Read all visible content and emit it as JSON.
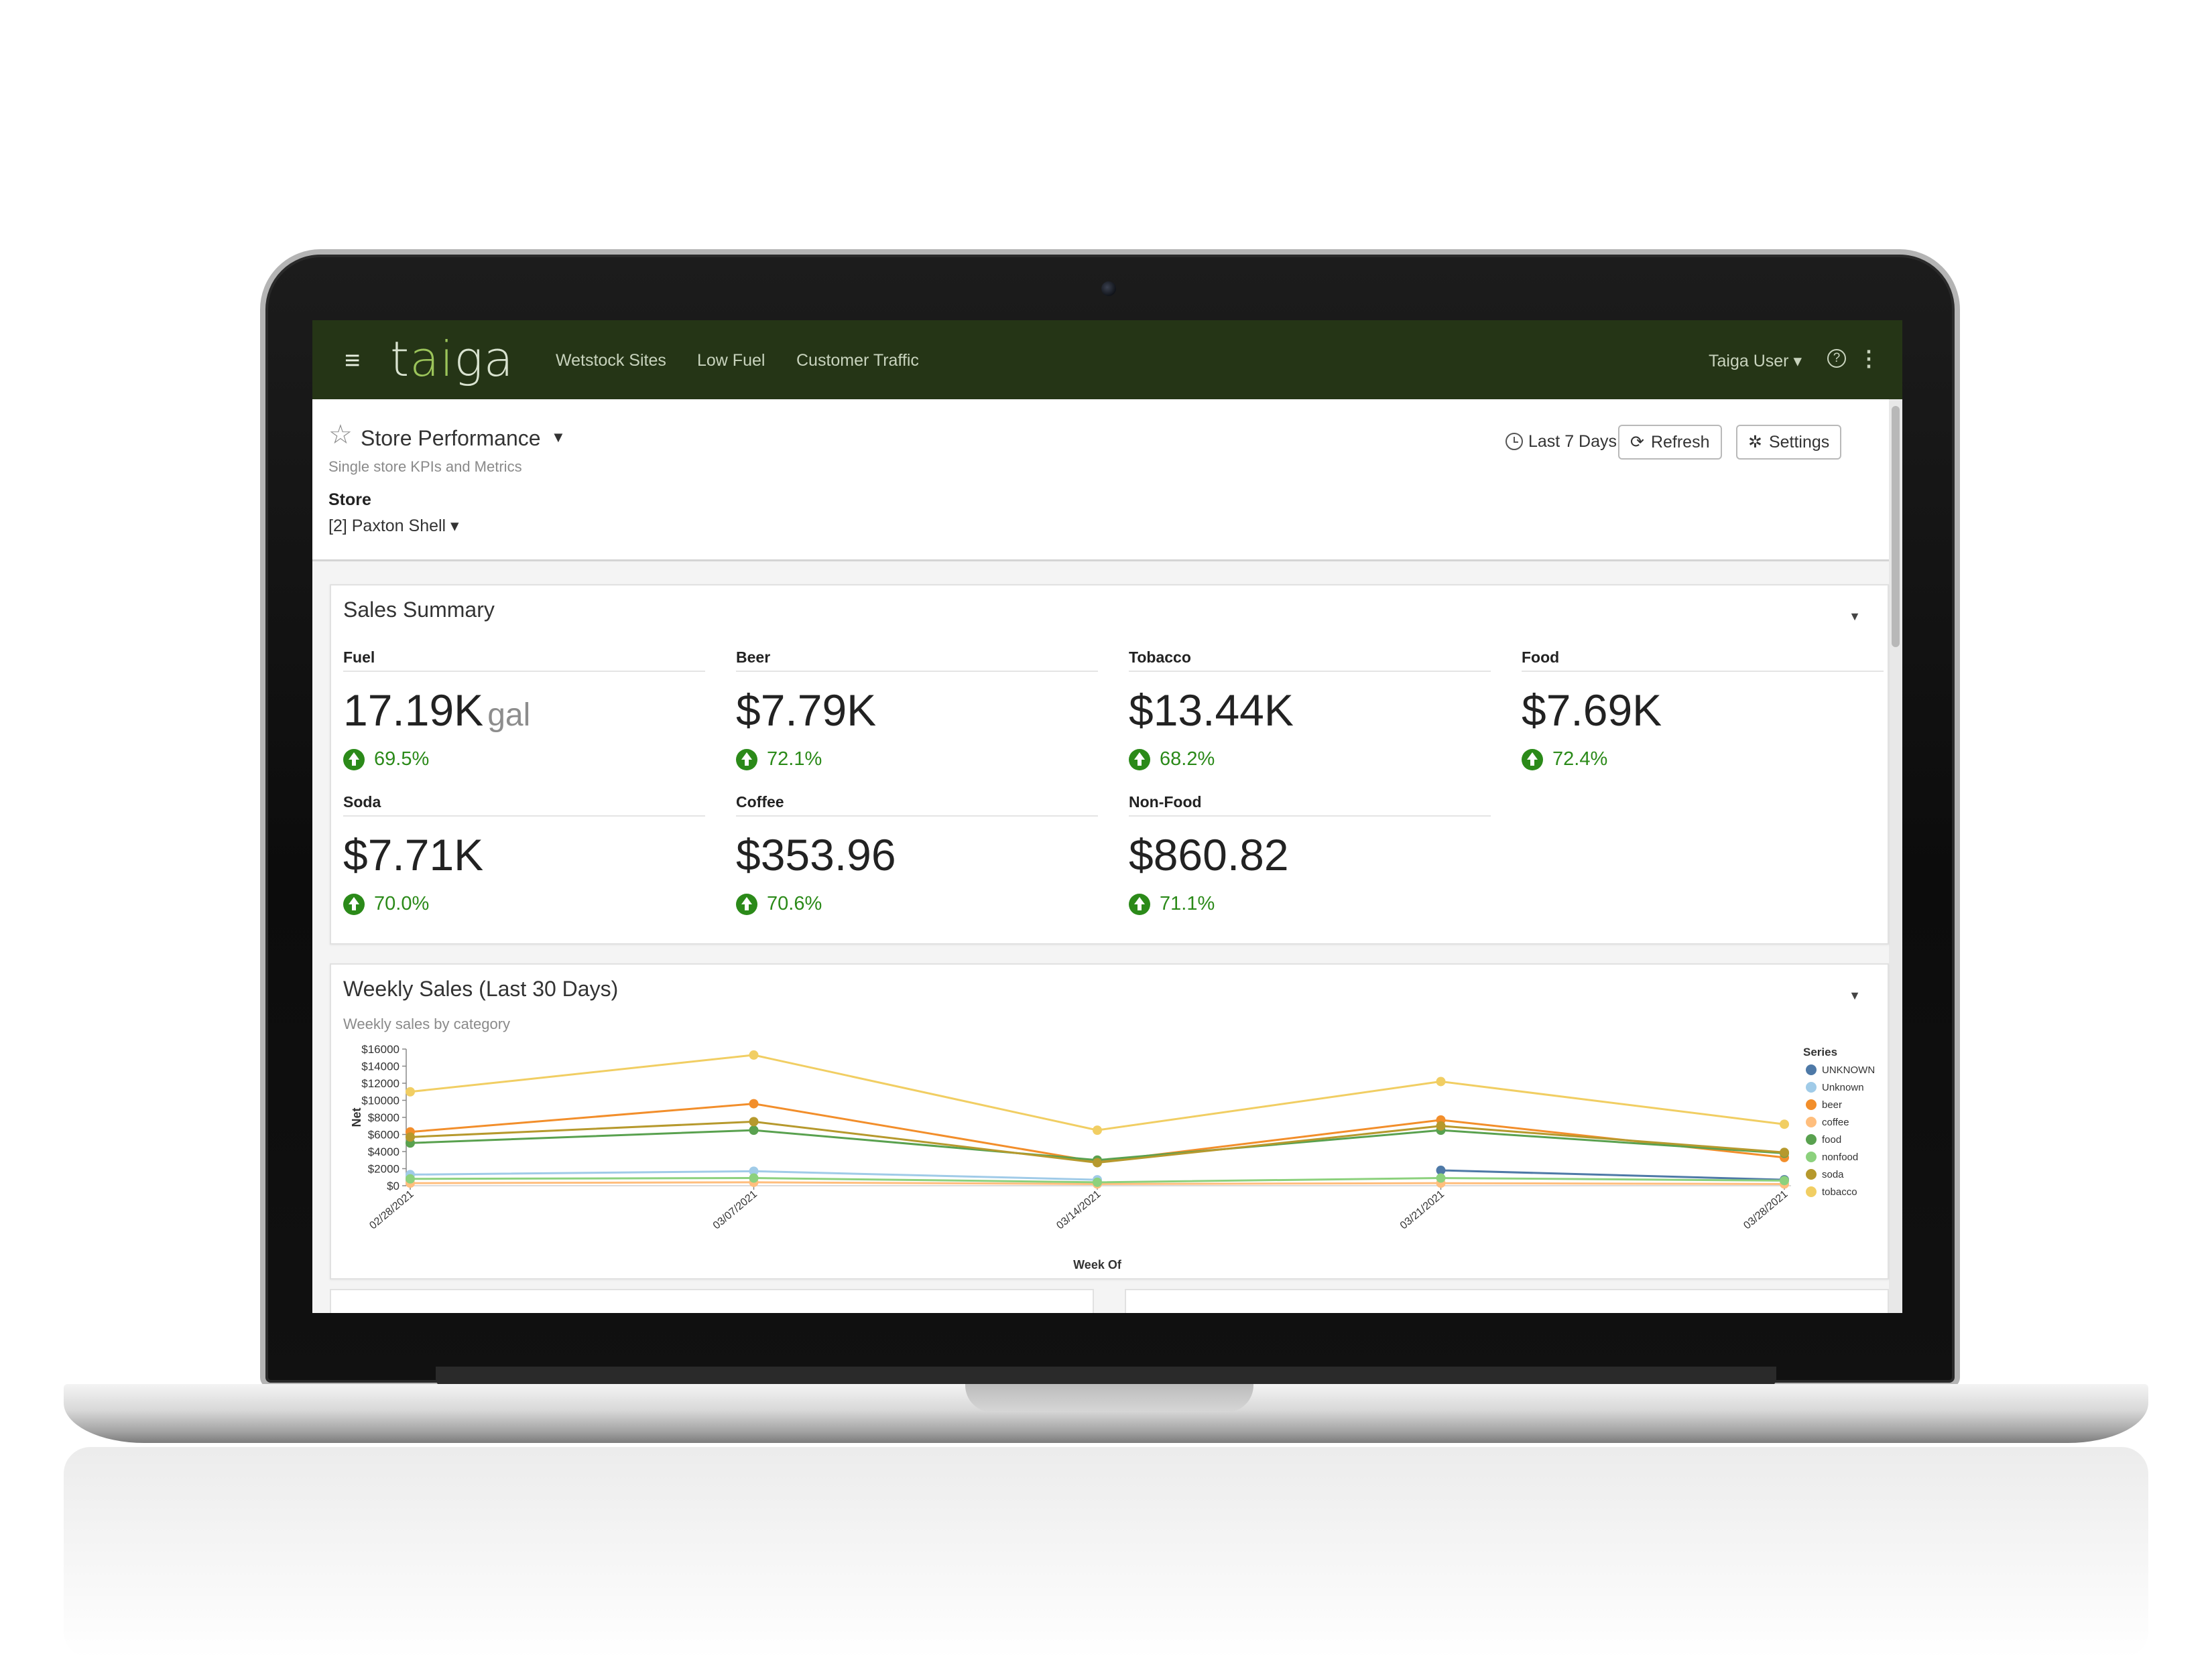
{
  "nav": {
    "menu_icon": "hamburger-icon",
    "logo_prefix": "t",
    "logo_mid": "ai",
    "logo_suffix": "ga",
    "links": [
      "Wetstock Sites",
      "Low Fuel",
      "Customer Traffic"
    ],
    "user": "Taiga User ▾",
    "help_icon": "question-circle-icon",
    "more_icon": "kebab-icon"
  },
  "header": {
    "title": "Store Performance",
    "subtitle": "Single store KPIs and Metrics",
    "store_label": "Store",
    "store_value": "[2] Paxton Shell ▾",
    "timerange": "Last 7 Days ▾",
    "refresh_label": "Refresh",
    "settings_label": "Settings"
  },
  "sales_summary": {
    "title": "Sales Summary",
    "kpis": [
      {
        "label": "Fuel",
        "value": "17.19K",
        "unit": "gal",
        "delta": "69.5%"
      },
      {
        "label": "Beer",
        "value": "$7.79K",
        "unit": "",
        "delta": "72.1%"
      },
      {
        "label": "Tobacco",
        "value": "$13.44K",
        "unit": "",
        "delta": "68.2%"
      },
      {
        "label": "Food",
        "value": "$7.69K",
        "unit": "",
        "delta": "72.4%"
      },
      {
        "label": "Soda",
        "value": "$7.71K",
        "unit": "",
        "delta": "70.0%"
      },
      {
        "label": "Coffee",
        "value": "$353.96",
        "unit": "",
        "delta": "70.6%"
      },
      {
        "label": "Non-Food",
        "value": "$860.82",
        "unit": "",
        "delta": "71.1%"
      }
    ]
  },
  "weekly": {
    "title": "Weekly Sales (Last 30 Days)",
    "subtitle": "Weekly sales by category"
  },
  "chart_data": {
    "type": "line",
    "xlabel": "Week Of",
    "ylabel": "Net",
    "ylim": [
      0,
      16000
    ],
    "yticks": [
      "$0",
      "$2000",
      "$4000",
      "$6000",
      "$8000",
      "$10000",
      "$12000",
      "$14000",
      "$16000"
    ],
    "categories": [
      "02/28/2021",
      "03/07/2021",
      "03/14/2021",
      "03/21/2021",
      "03/28/2021"
    ],
    "legend_title": "Series",
    "legend_position": "right",
    "series": [
      {
        "name": "UNKNOWN",
        "color": "#4e79a7",
        "values": [
          null,
          null,
          null,
          1800,
          700
        ]
      },
      {
        "name": "Unknown",
        "color": "#a0cbe8",
        "values": [
          1300,
          1700,
          700,
          null,
          null
        ]
      },
      {
        "name": "beer",
        "color": "#f28e2b",
        "values": [
          6300,
          9600,
          2800,
          7700,
          3300
        ]
      },
      {
        "name": "coffee",
        "color": "#ffbe7d",
        "values": [
          300,
          400,
          200,
          300,
          200
        ]
      },
      {
        "name": "food",
        "color": "#59a14f",
        "values": [
          5000,
          6500,
          3000,
          6500,
          3800
        ]
      },
      {
        "name": "nonfood",
        "color": "#8cd17d",
        "values": [
          800,
          900,
          400,
          900,
          600
        ]
      },
      {
        "name": "soda",
        "color": "#b6992d",
        "values": [
          5700,
          7500,
          2700,
          7000,
          3900
        ]
      },
      {
        "name": "tobacco",
        "color": "#f1ce63",
        "values": [
          11000,
          15300,
          6500,
          12200,
          7200
        ]
      }
    ]
  }
}
